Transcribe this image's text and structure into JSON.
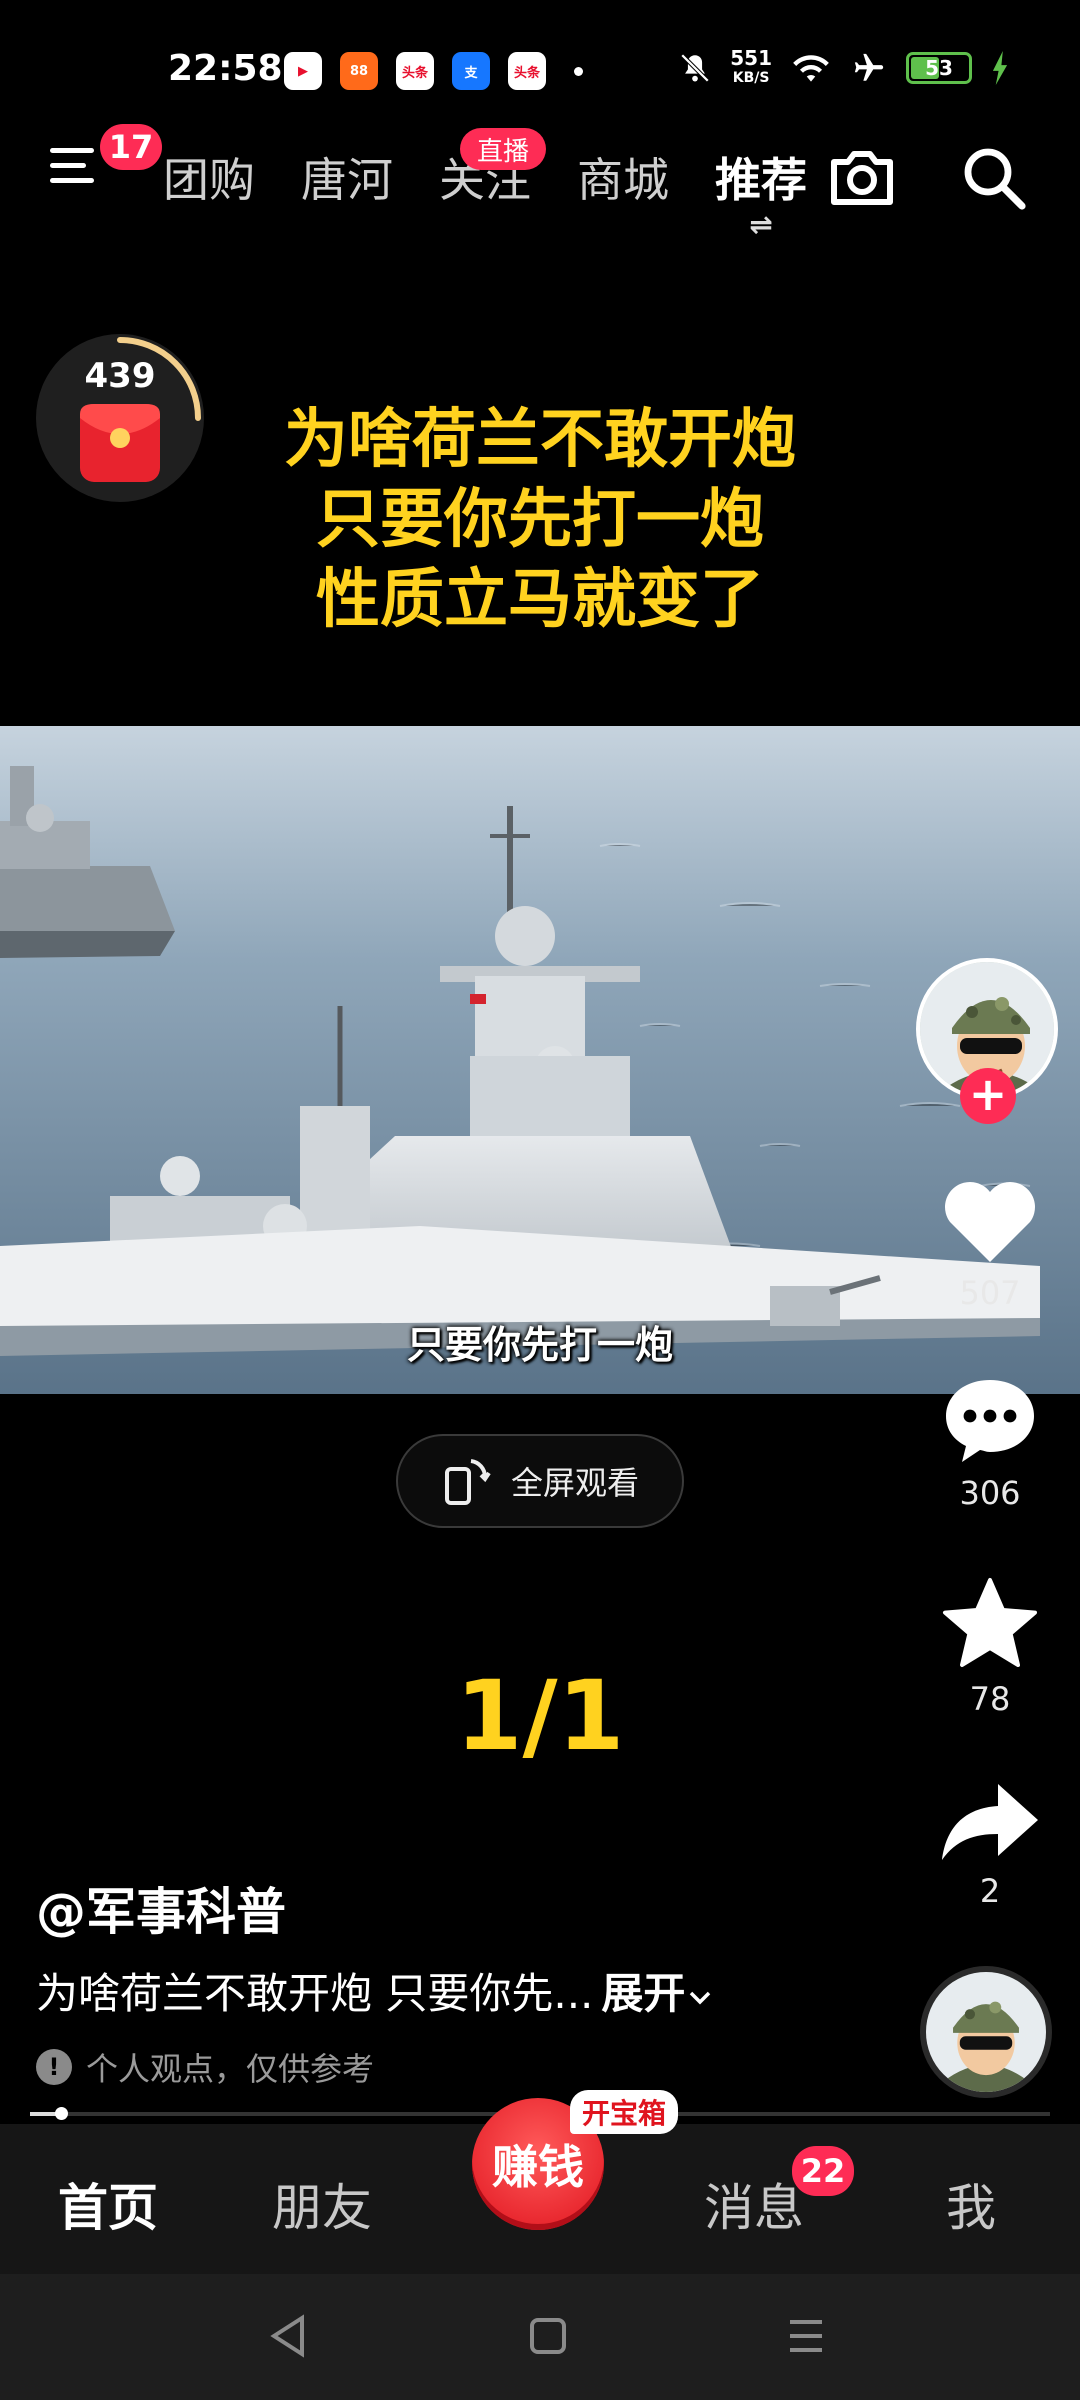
{
  "status_bar": {
    "time": "22:58",
    "app_icons": [
      {
        "label": "▶",
        "bg": "#ffffff",
        "fg": "#e8102e"
      },
      {
        "label": "88",
        "bg": "#ff6a1a",
        "fg": "#ffffff"
      },
      {
        "label": "头条",
        "bg": "#ffffff",
        "fg": "#e8102e"
      },
      {
        "label": "支",
        "bg": "#1677ff",
        "fg": "#ffffff"
      },
      {
        "label": "头条",
        "bg": "#ffffff",
        "fg": "#e8102e"
      }
    ],
    "net_speed_value": "551",
    "net_speed_unit": "KB/S",
    "battery": "53",
    "battery_level_percent": 53
  },
  "top_nav": {
    "menu_badge": "17",
    "tabs": [
      {
        "label": "团购"
      },
      {
        "label": "唐河"
      },
      {
        "label": "关注",
        "badge": "直播"
      },
      {
        "label": "商城"
      },
      {
        "label": "推荐",
        "active": true
      }
    ],
    "swap_symbol": "⇌"
  },
  "coin_widget": {
    "count": "439"
  },
  "headline": {
    "lines": [
      "为啥荷兰不敢开炮",
      "只要你先打一炮",
      "性质立马就变了"
    ]
  },
  "video": {
    "subtitle": "只要你先打一炮"
  },
  "fullscreen_button": {
    "label": "全屏观看"
  },
  "page_indicator": "1/1",
  "actions": {
    "likes": "507",
    "comments": "306",
    "favorites": "78",
    "shares": "2"
  },
  "post": {
    "author": "@军事科普",
    "description": "为啥荷兰不敢开炮 只要你先...",
    "expand_label": "展开",
    "notice": "个人观点，仅供参考",
    "notice_icon": "!"
  },
  "progress_percent": 3,
  "bottom_tabs": {
    "home": "首页",
    "friends": "朋友",
    "earn": "赚钱",
    "earn_tag": "开宝箱",
    "messages": "消息",
    "messages_badge": "22",
    "me": "我"
  },
  "colors": {
    "accent_red": "#fe2c55",
    "caption_yellow": "#ffd21f"
  }
}
